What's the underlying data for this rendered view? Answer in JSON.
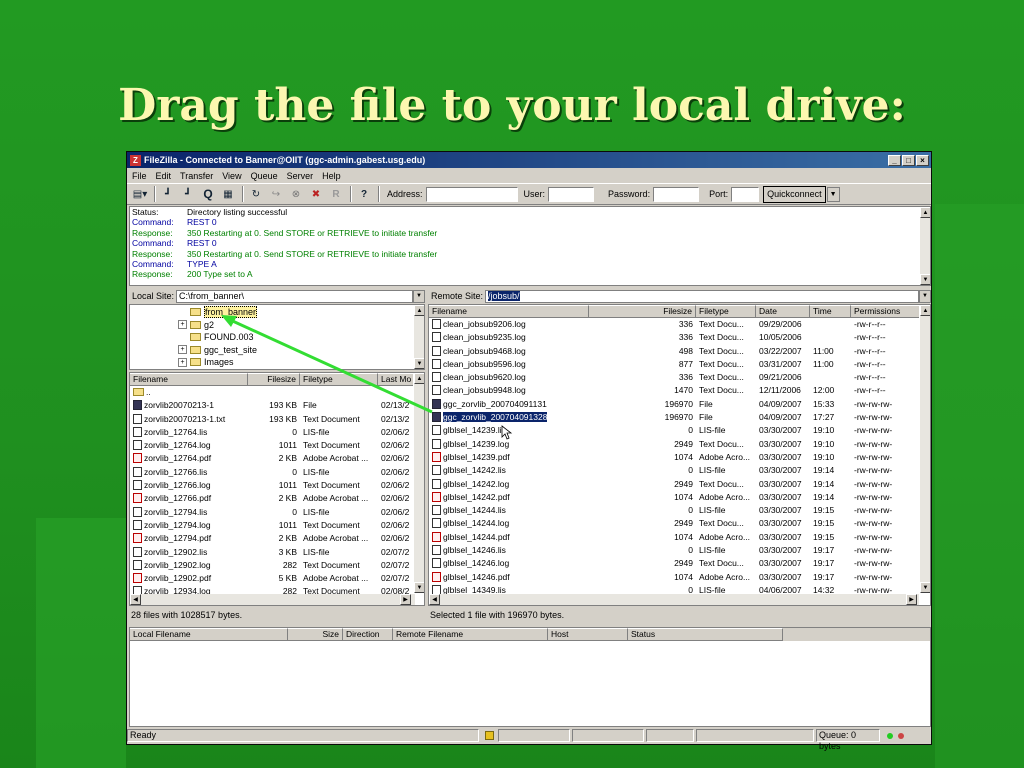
{
  "slide": {
    "title": "Drag the file to your local drive:"
  },
  "window": {
    "title": "FileZilla - Connected to Banner@OIIT (ggc-admin.gabest.usg.edu)",
    "controls": [
      "_",
      "□",
      "×"
    ]
  },
  "menu": [
    "File",
    "Edit",
    "Transfer",
    "View",
    "Queue",
    "Server",
    "Help"
  ],
  "toolbar": {
    "address_label": "Address:",
    "user_label": "User:",
    "password_label": "Password:",
    "port_label": "Port:",
    "quickconnect_label": "Quickconnect"
  },
  "log": [
    {
      "type": "status",
      "label": "Status:",
      "text": "Directory listing successful"
    },
    {
      "type": "command",
      "label": "Command:",
      "text": "REST 0"
    },
    {
      "type": "response",
      "label": "Response:",
      "text": "350 Restarting at 0. Send STORE or RETRIEVE to initiate transfer"
    },
    {
      "type": "command",
      "label": "Command:",
      "text": "REST 0"
    },
    {
      "type": "response",
      "label": "Response:",
      "text": "350 Restarting at 0. Send STORE or RETRIEVE to initiate transfer"
    },
    {
      "type": "command",
      "label": "Command:",
      "text": "TYPE A"
    },
    {
      "type": "response",
      "label": "Response:",
      "text": "200 Type set to A"
    }
  ],
  "local": {
    "site_label": "Local Site:",
    "path": "C:\\from_banner\\",
    "tree": [
      {
        "name": "from_banner",
        "expander": ""
      },
      {
        "name": "g2",
        "expander": "+"
      },
      {
        "name": "FOUND.003",
        "expander": ""
      },
      {
        "name": "ggc_test_site",
        "expander": "+"
      },
      {
        "name": "Images",
        "expander": "+"
      }
    ],
    "headers": [
      "Filename",
      "Filesize",
      "Filetype",
      "Last Mo"
    ],
    "files": [
      {
        "icon": "up",
        "name": "..",
        "size": "",
        "type": "",
        "date": ""
      },
      {
        "icon": "bin",
        "name": "zorvlib20070213-1",
        "size": "193 KB",
        "type": "File",
        "date": "02/13/2"
      },
      {
        "icon": "txt",
        "name": "zorvlib20070213-1.txt",
        "size": "193 KB",
        "type": "Text Document",
        "date": "02/13/2"
      },
      {
        "icon": "txt",
        "name": "zorvlib_12764.lis",
        "size": "0",
        "type": "LIS-file",
        "date": "02/06/2"
      },
      {
        "icon": "txt",
        "name": "zorvlib_12764.log",
        "size": "1011",
        "type": "Text Document",
        "date": "02/06/2"
      },
      {
        "icon": "pdf",
        "name": "zorvlib_12764.pdf",
        "size": "2 KB",
        "type": "Adobe Acrobat ...",
        "date": "02/06/2"
      },
      {
        "icon": "txt",
        "name": "zorvlib_12766.lis",
        "size": "0",
        "type": "LIS-file",
        "date": "02/06/2"
      },
      {
        "icon": "txt",
        "name": "zorvlib_12766.log",
        "size": "1011",
        "type": "Text Document",
        "date": "02/06/2"
      },
      {
        "icon": "pdf",
        "name": "zorvlib_12766.pdf",
        "size": "2 KB",
        "type": "Adobe Acrobat ...",
        "date": "02/06/2"
      },
      {
        "icon": "txt",
        "name": "zorvlib_12794.lis",
        "size": "0",
        "type": "LIS-file",
        "date": "02/06/2"
      },
      {
        "icon": "txt",
        "name": "zorvlib_12794.log",
        "size": "1011",
        "type": "Text Document",
        "date": "02/06/2"
      },
      {
        "icon": "pdf",
        "name": "zorvlib_12794.pdf",
        "size": "2 KB",
        "type": "Adobe Acrobat ...",
        "date": "02/06/2"
      },
      {
        "icon": "txt",
        "name": "zorvlib_12902.lis",
        "size": "3 KB",
        "type": "LIS-file",
        "date": "02/07/2"
      },
      {
        "icon": "txt",
        "name": "zorvlib_12902.log",
        "size": "282",
        "type": "Text Document",
        "date": "02/07/2"
      },
      {
        "icon": "pdf",
        "name": "zorvlib_12902.pdf",
        "size": "5 KB",
        "type": "Adobe Acrobat ...",
        "date": "02/07/2"
      },
      {
        "icon": "txt",
        "name": "zorvlib_12934.log",
        "size": "282",
        "type": "Text Document",
        "date": "02/08/2"
      }
    ],
    "status": "28 files with 1028517 bytes."
  },
  "remote": {
    "site_label": "Remote Site:",
    "path": "/jobsub/",
    "headers": [
      "Filename",
      "Filesize",
      "Filetype",
      "Date",
      "Time",
      "Permissions"
    ],
    "files": [
      {
        "icon": "txt",
        "name": "clean_jobsub9206.log",
        "size": "336",
        "type": "Text Docu...",
        "date": "09/29/2006",
        "time": "",
        "perm": "-rw-r--r--"
      },
      {
        "icon": "txt",
        "name": "clean_jobsub9235.log",
        "size": "336",
        "type": "Text Docu...",
        "date": "10/05/2006",
        "time": "",
        "perm": "-rw-r--r--"
      },
      {
        "icon": "txt",
        "name": "clean_jobsub9468.log",
        "size": "498",
        "type": "Text Docu...",
        "date": "03/22/2007",
        "time": "11:00",
        "perm": "-rw-r--r--"
      },
      {
        "icon": "txt",
        "name": "clean_jobsub9596.log",
        "size": "877",
        "type": "Text Docu...",
        "date": "03/31/2007",
        "time": "11:00",
        "perm": "-rw-r--r--"
      },
      {
        "icon": "txt",
        "name": "clean_jobsub9620.log",
        "size": "336",
        "type": "Text Docu...",
        "date": "09/21/2006",
        "time": "",
        "perm": "-rw-r--r--"
      },
      {
        "icon": "txt",
        "name": "clean_jobsub9948.log",
        "size": "1470",
        "type": "Text Docu...",
        "date": "12/11/2006",
        "time": "12:00",
        "perm": "-rw-r--r--"
      },
      {
        "icon": "bin",
        "name": "ggc_zorvlib_200704091131",
        "size": "196970",
        "type": "File",
        "date": "04/09/2007",
        "time": "15:33",
        "perm": "-rw-rw-rw-"
      },
      {
        "icon": "bin",
        "name": "ggc_zorvlib_200704091328",
        "size": "196970",
        "type": "File",
        "date": "04/09/2007",
        "time": "17:27",
        "perm": "-rw-rw-rw-",
        "selected": true
      },
      {
        "icon": "txt",
        "name": "glblsel_14239.lis",
        "size": "0",
        "type": "LIS-file",
        "date": "03/30/2007",
        "time": "19:10",
        "perm": "-rw-rw-rw-"
      },
      {
        "icon": "txt",
        "name": "glblsel_14239.log",
        "size": "2949",
        "type": "Text Docu...",
        "date": "03/30/2007",
        "time": "19:10",
        "perm": "-rw-rw-rw-"
      },
      {
        "icon": "pdf",
        "name": "glblsel_14239.pdf",
        "size": "1074",
        "type": "Adobe Acro...",
        "date": "03/30/2007",
        "time": "19:10",
        "perm": "-rw-rw-rw-"
      },
      {
        "icon": "txt",
        "name": "glblsel_14242.lis",
        "size": "0",
        "type": "LIS-file",
        "date": "03/30/2007",
        "time": "19:14",
        "perm": "-rw-rw-rw-"
      },
      {
        "icon": "txt",
        "name": "glblsel_14242.log",
        "size": "2949",
        "type": "Text Docu...",
        "date": "03/30/2007",
        "time": "19:14",
        "perm": "-rw-rw-rw-"
      },
      {
        "icon": "pdf",
        "name": "glblsel_14242.pdf",
        "size": "1074",
        "type": "Adobe Acro...",
        "date": "03/30/2007",
        "time": "19:14",
        "perm": "-rw-rw-rw-"
      },
      {
        "icon": "txt",
        "name": "glblsel_14244.lis",
        "size": "0",
        "type": "LIS-file",
        "date": "03/30/2007",
        "time": "19:15",
        "perm": "-rw-rw-rw-"
      },
      {
        "icon": "txt",
        "name": "glblsel_14244.log",
        "size": "2949",
        "type": "Text Docu...",
        "date": "03/30/2007",
        "time": "19:15",
        "perm": "-rw-rw-rw-"
      },
      {
        "icon": "pdf",
        "name": "glblsel_14244.pdf",
        "size": "1074",
        "type": "Adobe Acro...",
        "date": "03/30/2007",
        "time": "19:15",
        "perm": "-rw-rw-rw-"
      },
      {
        "icon": "txt",
        "name": "glblsel_14246.lis",
        "size": "0",
        "type": "LIS-file",
        "date": "03/30/2007",
        "time": "19:17",
        "perm": "-rw-rw-rw-"
      },
      {
        "icon": "txt",
        "name": "glblsel_14246.log",
        "size": "2949",
        "type": "Text Docu...",
        "date": "03/30/2007",
        "time": "19:17",
        "perm": "-rw-rw-rw-"
      },
      {
        "icon": "pdf",
        "name": "glblsel_14246.pdf",
        "size": "1074",
        "type": "Adobe Acro...",
        "date": "03/30/2007",
        "time": "19:17",
        "perm": "-rw-rw-rw-"
      },
      {
        "icon": "txt",
        "name": "glblsel_14349.lis",
        "size": "0",
        "type": "LIS-file",
        "date": "04/06/2007",
        "time": "14:32",
        "perm": "-rw-rw-rw-"
      }
    ],
    "status": "Selected 1 file with 196970 bytes."
  },
  "queue": {
    "headers": [
      "Local Filename",
      "Size",
      "Direction",
      "Remote Filename",
      "Host",
      "Status"
    ]
  },
  "statusbar": {
    "ready": "Ready",
    "queue": "Queue: 0 bytes"
  },
  "colors": {
    "slide_bg": "#1f8f1f",
    "title": "#fcf7b0",
    "arrow": "#33dd33",
    "selection": "#0a246a"
  }
}
